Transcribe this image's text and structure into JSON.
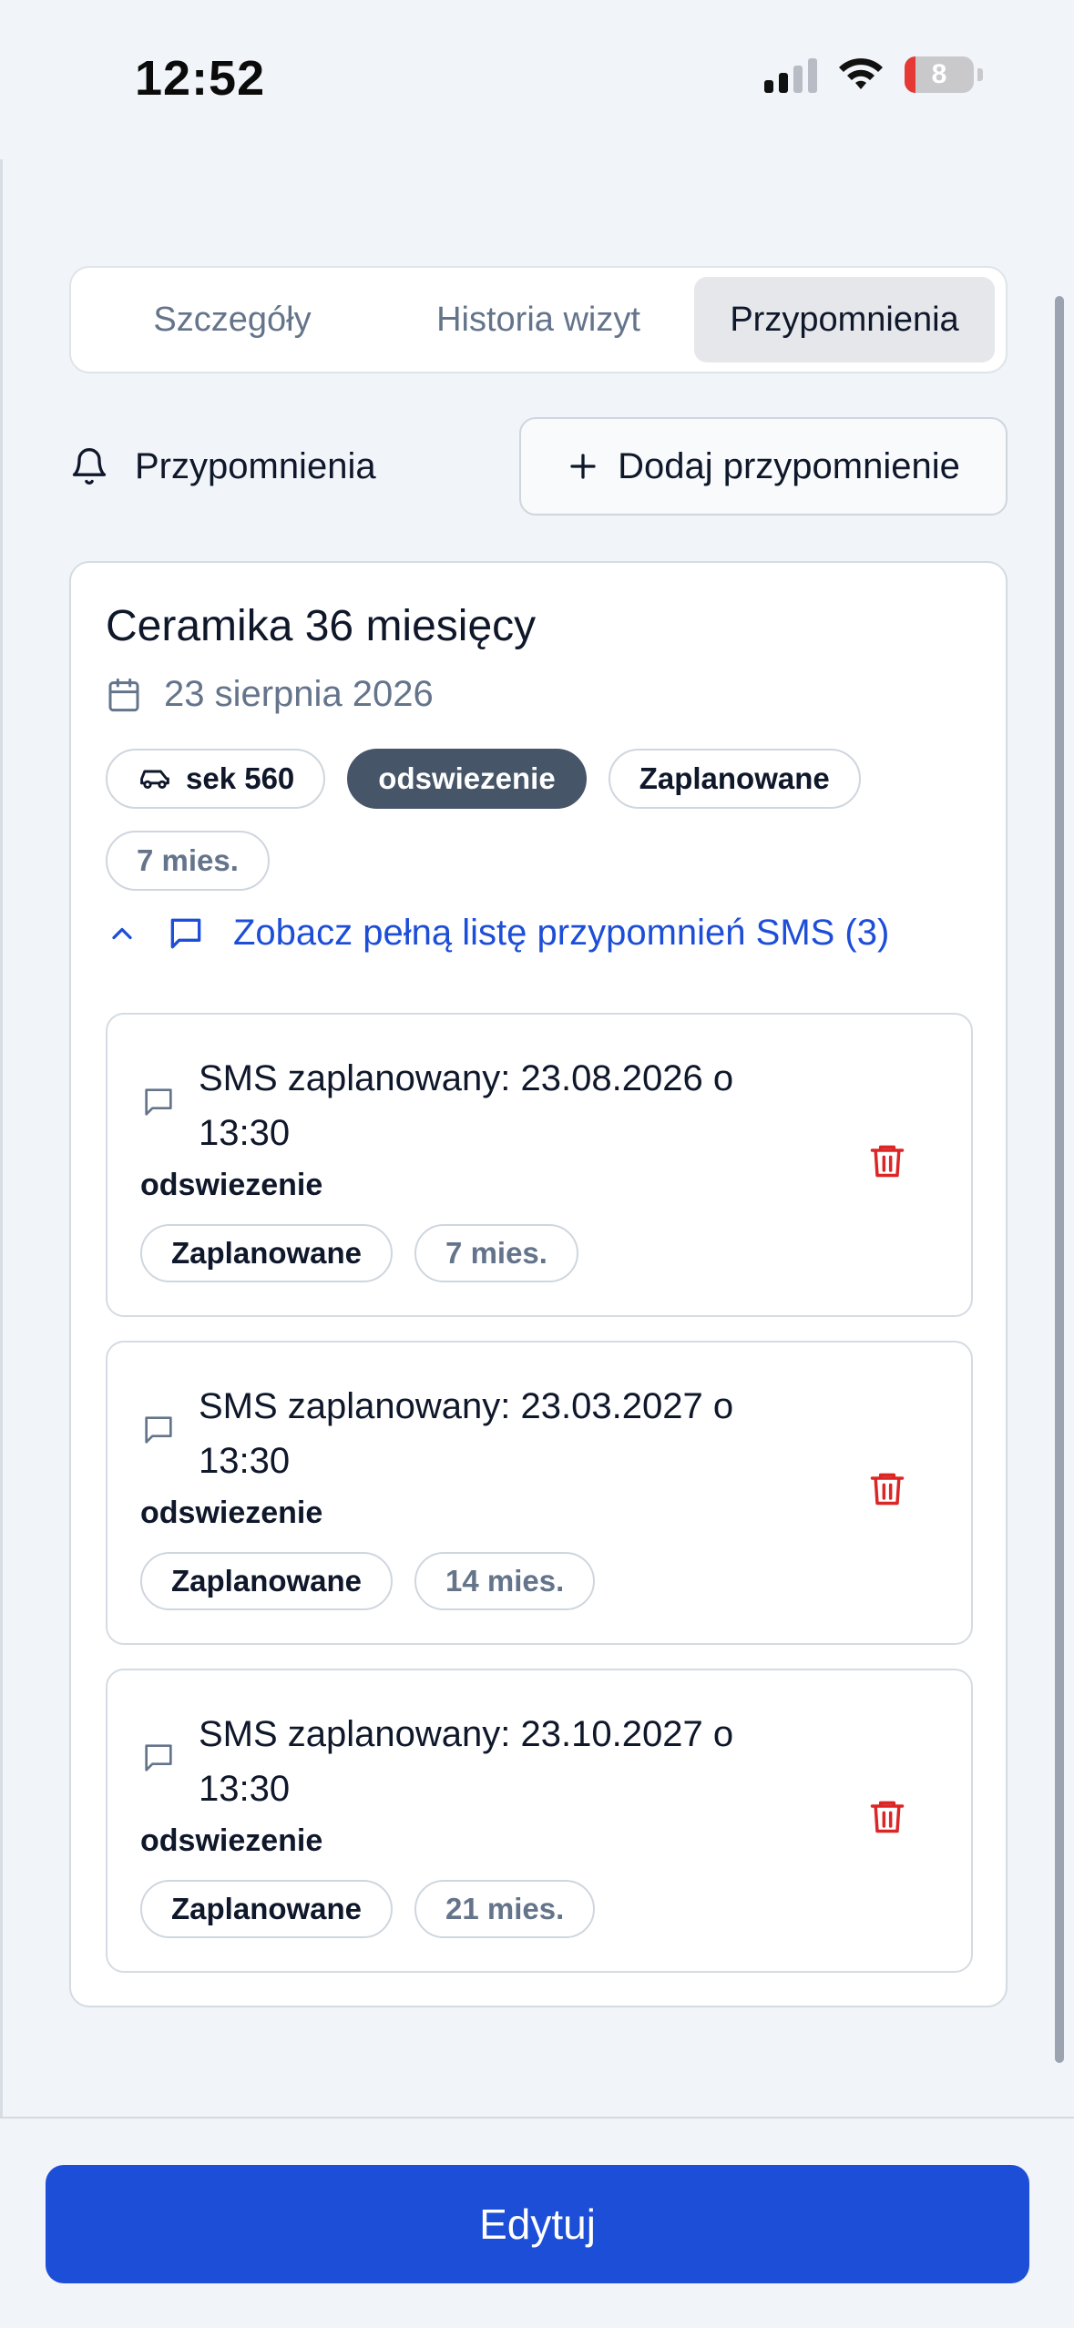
{
  "status_bar": {
    "time": "12:52",
    "battery": "8"
  },
  "tabs": [
    {
      "label": "Szczegóły",
      "active": false
    },
    {
      "label": "Historia wizyt",
      "active": false
    },
    {
      "label": "Przypomnienia",
      "active": true
    }
  ],
  "reminders": {
    "title": "Przypomnienia",
    "add_button": "Dodaj przypomnienie"
  },
  "card": {
    "title": "Ceramika 36 miesięcy",
    "date": "23 sierpnia 2026",
    "chips": {
      "car": "sek 560",
      "type": "odswiezenie",
      "status": "Zaplanowane",
      "interval": "7 mies."
    },
    "sms_toggle": "Zobacz pełną listę przypomnień SMS (3)",
    "sms_items": [
      {
        "text": "SMS zaplanowany: 23.08.2026 o 13:30",
        "type": "odswiezenie",
        "status": "Zaplanowane",
        "interval": "7 mies."
      },
      {
        "text": "SMS zaplanowany: 23.03.2027 o 13:30",
        "type": "odswiezenie",
        "status": "Zaplanowane",
        "interval": "14 mies."
      },
      {
        "text": "SMS zaplanowany: 23.10.2027 o 13:30",
        "type": "odswiezenie",
        "status": "Zaplanowane",
        "interval": "21 mies."
      }
    ]
  },
  "edit_button": "Edytuj",
  "colors": {
    "accent": "#1d4ed8",
    "danger": "#dc2626",
    "dark_chip": "#475569"
  }
}
